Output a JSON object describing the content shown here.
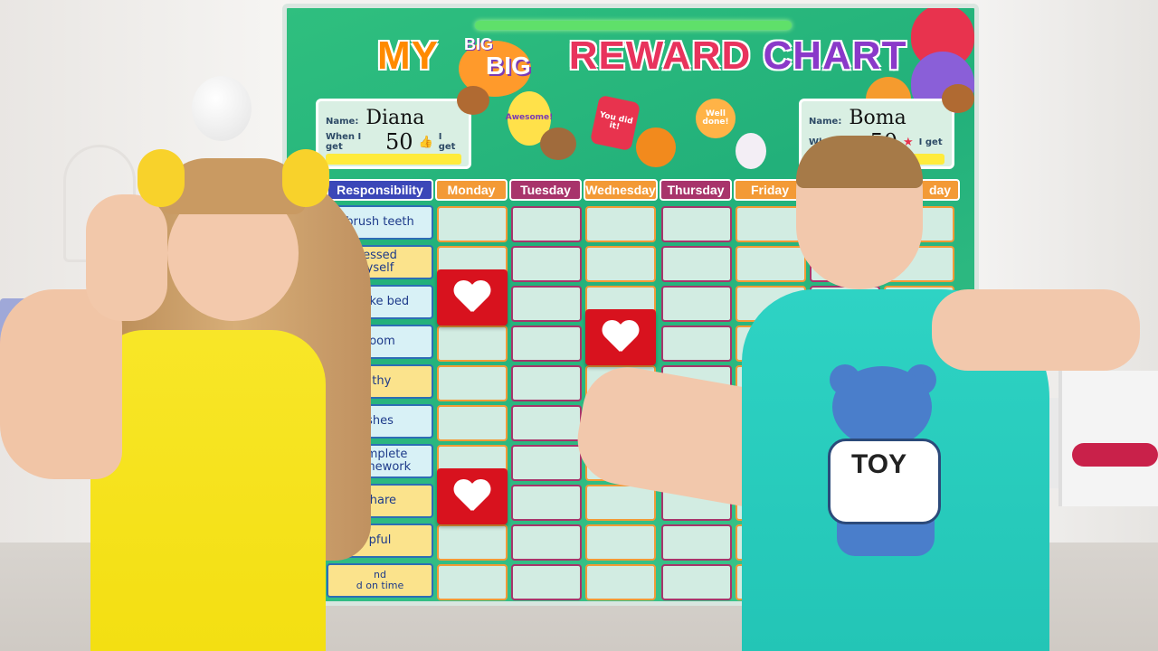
{
  "board": {
    "title_parts": [
      "MY",
      "BIG",
      "BIG",
      "REWARD",
      "CHART"
    ],
    "name_label": "Name:",
    "when_label": "When I get",
    "get_label": "I get",
    "children": [
      {
        "name": "Diana",
        "goal": "50"
      },
      {
        "name": "Boma",
        "goal": "50"
      }
    ],
    "bubbles": [
      "Awesome!",
      "You did it!",
      "Well done!"
    ],
    "header_label": "Responsibility",
    "days": [
      "Monday",
      "Tuesday",
      "Wednesday",
      "Thursday",
      "Friday",
      "day"
    ],
    "responsibilities": [
      "brush teeth",
      "essed\nyself",
      "make bed",
      "room",
      "lthy",
      "shes",
      "complete\nhomework",
      "share",
      "pful",
      "nd\nd on time"
    ],
    "hearts": [
      {
        "row": 1,
        "col": 0
      },
      {
        "row": 2,
        "col": 2
      },
      {
        "row": 6,
        "col": 0
      }
    ]
  },
  "shirt_text": "TOY",
  "colors": {
    "board_green": "#2fbf7f",
    "monday": "#f39a36",
    "tuesday": "#a8346b",
    "wednesday": "#f39a36",
    "thursday": "#a8346b",
    "friday": "#f39a36",
    "responsibility": "#3b47b8",
    "heart_magnet": "#d8121e",
    "girl_dress": "#f8e628",
    "boy_shirt": "#2ed3c4"
  }
}
